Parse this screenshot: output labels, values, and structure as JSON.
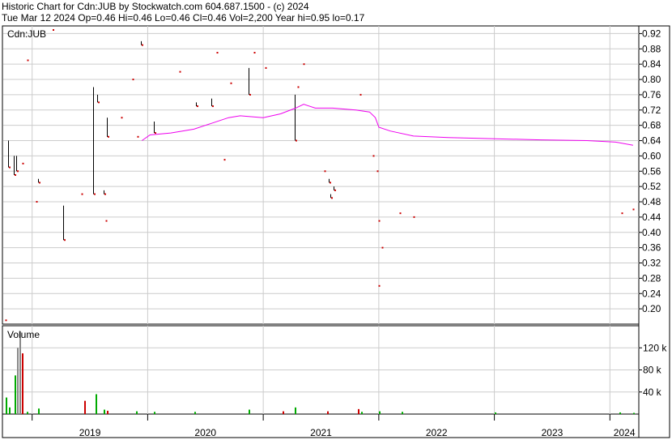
{
  "header": {
    "line1": "Historic Chart for Cdn:JUB by Stockwatch.com 604.687.1500 - (c) 2024",
    "line2": "Tue Mar 12 2024  Op=0.46  Hi=0.46  Lo=0.46  Cl=0.46  Vol=2,200  Year hi=0.95  lo=0.17"
  },
  "chart_data": {
    "type": "line",
    "symbol_label": "Cdn:JUB",
    "volume_label": "Volume",
    "price_axis": {
      "ticks": [
        "0.92",
        "0.88",
        "0.84",
        "0.80",
        "0.76",
        "0.72",
        "0.68",
        "0.64",
        "0.60",
        "0.56",
        "0.52",
        "0.48",
        "0.44",
        "0.40",
        "0.36",
        "0.32",
        "0.28",
        "0.24",
        "0.20"
      ],
      "ylim": [
        0.16,
        0.94
      ]
    },
    "volume_axis": {
      "ticks": [
        "120 k",
        "80 k",
        "40 k"
      ],
      "ylim": [
        0,
        160000
      ]
    },
    "x_axis": {
      "labels": [
        "2019",
        "2020",
        "2021",
        "2022",
        "2023",
        "2024"
      ],
      "xlim": [
        2018.75,
        2024.25
      ]
    },
    "colors": {
      "bar": "#000000",
      "down_tick": "#cc0000",
      "moving_average": "#ee00ee",
      "volume_up": "#00aa00",
      "volume_down": "#cc0000",
      "volume_flat": "#888888",
      "grid": "#cccccc"
    },
    "price_bars": [
      {
        "x": 2018.77,
        "hi": 0.17,
        "lo": 0.17
      },
      {
        "x": 2018.79,
        "hi": 0.64,
        "lo": 0.57
      },
      {
        "x": 2018.84,
        "hi": 0.6,
        "lo": 0.55
      },
      {
        "x": 2018.86,
        "hi": 0.6,
        "lo": 0.56
      },
      {
        "x": 2018.92,
        "hi": 0.58,
        "lo": 0.58
      },
      {
        "x": 2018.96,
        "hi": 0.85,
        "lo": 0.85
      },
      {
        "x": 2019.04,
        "hi": 0.48,
        "lo": 0.48
      },
      {
        "x": 2019.05,
        "hi": 0.54,
        "lo": 0.53
      },
      {
        "x": 2019.27,
        "hi": 0.47,
        "lo": 0.38
      },
      {
        "x": 2019.43,
        "hi": 0.5,
        "lo": 0.5
      },
      {
        "x": 2019.53,
        "hi": 0.78,
        "lo": 0.5
      },
      {
        "x": 2019.56,
        "hi": 0.76,
        "lo": 0.74
      },
      {
        "x": 2019.62,
        "hi": 0.51,
        "lo": 0.5
      },
      {
        "x": 2019.64,
        "hi": 0.43,
        "lo": 0.43
      },
      {
        "x": 2019.65,
        "hi": 0.7,
        "lo": 0.65
      },
      {
        "x": 2019.77,
        "hi": 0.7,
        "lo": 0.7
      },
      {
        "x": 2019.87,
        "hi": 0.8,
        "lo": 0.8
      },
      {
        "x": 2019.91,
        "hi": 0.65,
        "lo": 0.65
      },
      {
        "x": 2019.94,
        "hi": 0.9,
        "lo": 0.89
      },
      {
        "x": 2020.05,
        "hi": 0.69,
        "lo": 0.66
      },
      {
        "x": 2020.28,
        "hi": 0.82,
        "lo": 0.82
      },
      {
        "x": 2020.42,
        "hi": 0.74,
        "lo": 0.73
      },
      {
        "x": 2020.55,
        "hi": 0.75,
        "lo": 0.73
      },
      {
        "x": 2020.6,
        "hi": 0.87,
        "lo": 0.87
      },
      {
        "x": 2020.66,
        "hi": 0.59,
        "lo": 0.59
      },
      {
        "x": 2020.72,
        "hi": 0.79,
        "lo": 0.79
      },
      {
        "x": 2020.87,
        "hi": 0.83,
        "lo": 0.76
      },
      {
        "x": 2020.92,
        "hi": 0.87,
        "lo": 0.87
      },
      {
        "x": 2021.02,
        "hi": 0.83,
        "lo": 0.83
      },
      {
        "x": 2021.27,
        "hi": 0.76,
        "lo": 0.64
      },
      {
        "x": 2021.3,
        "hi": 0.78,
        "lo": 0.78
      },
      {
        "x": 2021.35,
        "hi": 0.84,
        "lo": 0.84
      },
      {
        "x": 2021.53,
        "hi": 0.56,
        "lo": 0.56
      },
      {
        "x": 2021.57,
        "hi": 0.54,
        "lo": 0.53
      },
      {
        "x": 2021.58,
        "hi": 0.5,
        "lo": 0.49
      },
      {
        "x": 2021.61,
        "hi": 0.52,
        "lo": 0.51
      },
      {
        "x": 2021.84,
        "hi": 0.76,
        "lo": 0.76
      },
      {
        "x": 2021.95,
        "hi": 0.6,
        "lo": 0.6
      },
      {
        "x": 2021.99,
        "hi": 0.56,
        "lo": 0.56
      },
      {
        "x": 2022.0,
        "hi": 0.43,
        "lo": 0.43
      },
      {
        "x": 2022.0,
        "hi": 0.26,
        "lo": 0.26
      },
      {
        "x": 2022.03,
        "hi": 0.36,
        "lo": 0.36
      },
      {
        "x": 2022.18,
        "hi": 0.45,
        "lo": 0.45
      },
      {
        "x": 2022.3,
        "hi": 0.44,
        "lo": 0.44
      },
      {
        "x": 2024.1,
        "hi": 0.45,
        "lo": 0.45
      },
      {
        "x": 2024.2,
        "hi": 0.46,
        "lo": 0.46
      }
    ],
    "moving_average": [
      {
        "x": 2019.95,
        "y": 0.64
      },
      {
        "x": 2020.02,
        "y": 0.655
      },
      {
        "x": 2020.2,
        "y": 0.66
      },
      {
        "x": 2020.4,
        "y": 0.67
      },
      {
        "x": 2020.55,
        "y": 0.685
      },
      {
        "x": 2020.7,
        "y": 0.7
      },
      {
        "x": 2020.8,
        "y": 0.705
      },
      {
        "x": 2021.0,
        "y": 0.7
      },
      {
        "x": 2021.15,
        "y": 0.71
      },
      {
        "x": 2021.28,
        "y": 0.725
      },
      {
        "x": 2021.35,
        "y": 0.735
      },
      {
        "x": 2021.45,
        "y": 0.725
      },
      {
        "x": 2021.6,
        "y": 0.725
      },
      {
        "x": 2021.8,
        "y": 0.72
      },
      {
        "x": 2021.92,
        "y": 0.715
      },
      {
        "x": 2021.97,
        "y": 0.7
      },
      {
        "x": 2022.0,
        "y": 0.675
      },
      {
        "x": 2022.1,
        "y": 0.665
      },
      {
        "x": 2022.3,
        "y": 0.652
      },
      {
        "x": 2022.6,
        "y": 0.648
      },
      {
        "x": 2023.0,
        "y": 0.645
      },
      {
        "x": 2023.4,
        "y": 0.642
      },
      {
        "x": 2023.8,
        "y": 0.64
      },
      {
        "x": 2024.05,
        "y": 0.636
      },
      {
        "x": 2024.2,
        "y": 0.628
      }
    ],
    "volume_bars": [
      {
        "x": 2018.77,
        "v": 30000,
        "c": "up"
      },
      {
        "x": 2018.8,
        "v": 12000,
        "c": "up"
      },
      {
        "x": 2018.85,
        "v": 70000,
        "c": "up"
      },
      {
        "x": 2018.87,
        "v": 120000,
        "c": "flat"
      },
      {
        "x": 2018.89,
        "v": 150000,
        "c": "flat"
      },
      {
        "x": 2018.91,
        "v": 110000,
        "c": "down"
      },
      {
        "x": 2018.95,
        "v": 4000,
        "c": "up"
      },
      {
        "x": 2019.05,
        "v": 10000,
        "c": "up"
      },
      {
        "x": 2019.45,
        "v": 24000,
        "c": "down"
      },
      {
        "x": 2019.55,
        "v": 36000,
        "c": "up"
      },
      {
        "x": 2019.62,
        "v": 8000,
        "c": "up"
      },
      {
        "x": 2019.65,
        "v": 6000,
        "c": "down"
      },
      {
        "x": 2019.9,
        "v": 5000,
        "c": "up"
      },
      {
        "x": 2020.05,
        "v": 4000,
        "c": "up"
      },
      {
        "x": 2020.4,
        "v": 4000,
        "c": "up"
      },
      {
        "x": 2020.87,
        "v": 8000,
        "c": "up"
      },
      {
        "x": 2021.17,
        "v": 5000,
        "c": "down"
      },
      {
        "x": 2021.27,
        "v": 12000,
        "c": "up"
      },
      {
        "x": 2021.55,
        "v": 5000,
        "c": "down"
      },
      {
        "x": 2021.82,
        "v": 9000,
        "c": "down"
      },
      {
        "x": 2021.85,
        "v": 4000,
        "c": "up"
      },
      {
        "x": 2022.0,
        "v": 5000,
        "c": "up"
      },
      {
        "x": 2022.2,
        "v": 4000,
        "c": "up"
      },
      {
        "x": 2023.0,
        "v": 3000,
        "c": "up"
      },
      {
        "x": 2024.08,
        "v": 3000,
        "c": "up"
      },
      {
        "x": 2024.2,
        "v": 2200,
        "c": "up"
      }
    ]
  }
}
